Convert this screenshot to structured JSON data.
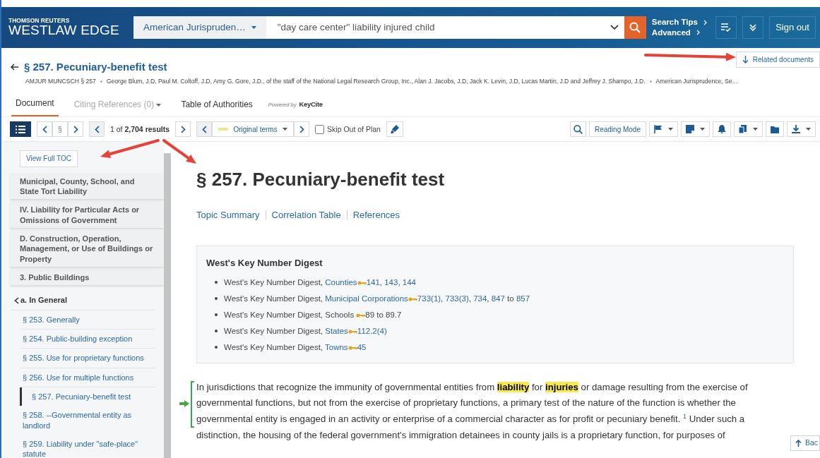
{
  "header": {
    "brand_top": "THOMSON REUTERS",
    "brand": "WESTLAW EDGE",
    "scope": "American Jurispruden…",
    "query": "\"day care center\" liability injured child",
    "links": [
      "Search Tips",
      "Advanced"
    ],
    "sign_out": "Sign out"
  },
  "document": {
    "title": "§ 257. Pecuniary-benefit test",
    "meta": [
      "AMJUR MUNCSCH § 257",
      "George Blum, J.D, Paul M. Coltoff, J.D, Amy G. Gore, J.D., of the staff of the National Legal Research Group, Inc., Alan J. Jacobs, J.D, Jack K. Levin, J.D, Lucas Martin, J.D and Jeffrey J. Shampo, J.D.",
      "American Jurisprudence, Se…"
    ],
    "related": "Related documents"
  },
  "tabs": [
    {
      "label": "Document",
      "selected": true,
      "disabled": false,
      "caret": false
    },
    {
      "label": "Citing References (0)",
      "selected": false,
      "disabled": true,
      "caret": true
    },
    {
      "label": "Table of Authorities",
      "selected": false,
      "disabled": false,
      "caret": false
    }
  ],
  "powered_by": {
    "prefix": "Powered by",
    "brand": "KeyCite"
  },
  "toolbar": {
    "section": "§",
    "results": "1 of **2,704 results**",
    "terms": "Original terms",
    "skip": {
      "label": "Skip Out of Plan",
      "checked": false
    },
    "reading_mode": "Reading Mode"
  },
  "toc": {
    "view_full": "View Full TOC",
    "ancestors": [
      "Municipal, County, School, and State Tort Liability",
      "IV. Liability for Particular Acts or Omissions of Government",
      "D. Construction, Operation, Management, or Use of Buildings or Property",
      "3. Public Buildings"
    ],
    "group": "a. In General",
    "items": [
      {
        "label": "§ 253. Generally",
        "selected": false
      },
      {
        "label": "§ 254. Public-building exception",
        "selected": false
      },
      {
        "label": "§ 255. Use for proprietary functions",
        "selected": false
      },
      {
        "label": "§ 256. Use for multiple functions",
        "selected": false
      },
      {
        "label": "§ 257. Pecuniary-benefit test",
        "selected": true
      },
      {
        "label": "§ 258. --Governmental entity as landlord",
        "selected": false
      },
      {
        "label": "§ 259. Liability under \"safe-place\" statute",
        "selected": false
      }
    ]
  },
  "content": {
    "heading": "§ 257. Pecuniary-benefit test",
    "links": [
      "Topic Summary",
      "Correlation Table",
      "References"
    ],
    "digest": {
      "title": "West's Key Number Digest",
      "items": [
        [
          {
            "kind": "text",
            "text": "West's Key Number Digest, "
          },
          {
            "kind": "link",
            "text": "Counties"
          },
          {
            "kind": "key"
          },
          {
            "kind": "link",
            "text": "141"
          },
          {
            "kind": "text",
            "text": ", "
          },
          {
            "kind": "link",
            "text": "143"
          },
          {
            "kind": "text",
            "text": ", "
          },
          {
            "kind": "link",
            "text": "144"
          }
        ],
        [
          {
            "kind": "text",
            "text": "West's Key Number Digest, "
          },
          {
            "kind": "link",
            "text": "Municipal Corporations"
          },
          {
            "kind": "key"
          },
          {
            "kind": "link",
            "text": "733(1)"
          },
          {
            "kind": "text",
            "text": ", "
          },
          {
            "kind": "link",
            "text": "733(3)"
          },
          {
            "kind": "text",
            "text": ", "
          },
          {
            "kind": "link",
            "text": "734"
          },
          {
            "kind": "text",
            "text": ", "
          },
          {
            "kind": "link",
            "text": "847"
          },
          {
            "kind": "text",
            "text": " to "
          },
          {
            "kind": "link",
            "text": "857"
          }
        ],
        [
          {
            "kind": "text",
            "text": "West's Key Number Digest, Schools "
          },
          {
            "kind": "key"
          },
          {
            "kind": "text",
            "text": "89 to 89.7"
          }
        ],
        [
          {
            "kind": "text",
            "text": "West's Key Number Digest, "
          },
          {
            "kind": "link",
            "text": "States"
          },
          {
            "kind": "key"
          },
          {
            "kind": "link",
            "text": "112.2(4)"
          }
        ],
        [
          {
            "kind": "text",
            "text": "West's Key Number Digest, "
          },
          {
            "kind": "link",
            "text": "Towns"
          },
          {
            "kind": "key"
          },
          {
            "kind": "link",
            "text": "45"
          }
        ]
      ]
    },
    "paragraph": [
      {
        "kind": "text",
        "text": "In jurisdictions that recognize the immunity of governmental entities from "
      },
      {
        "kind": "hit",
        "text": "liability"
      },
      {
        "kind": "text",
        "text": " for "
      },
      {
        "kind": "hit",
        "text": "injuries"
      },
      {
        "kind": "text",
        "text": " or damage resulting from the exercise of governmental functions, but not from the exercise of proprietary functions, a primary test of the nature of the function is whether the governmental entity is engaged in an activity or enterprise of a commercial character as for profit or pecuniary benefit. "
      },
      {
        "kind": "footnote",
        "text": "1"
      },
      {
        "kind": "text",
        "text": "  Under such a distinction, the housing of the federal government's immigration detainees in county jails is a proprietary function, for purposes of"
      }
    ],
    "back_to_top": "Bac"
  }
}
